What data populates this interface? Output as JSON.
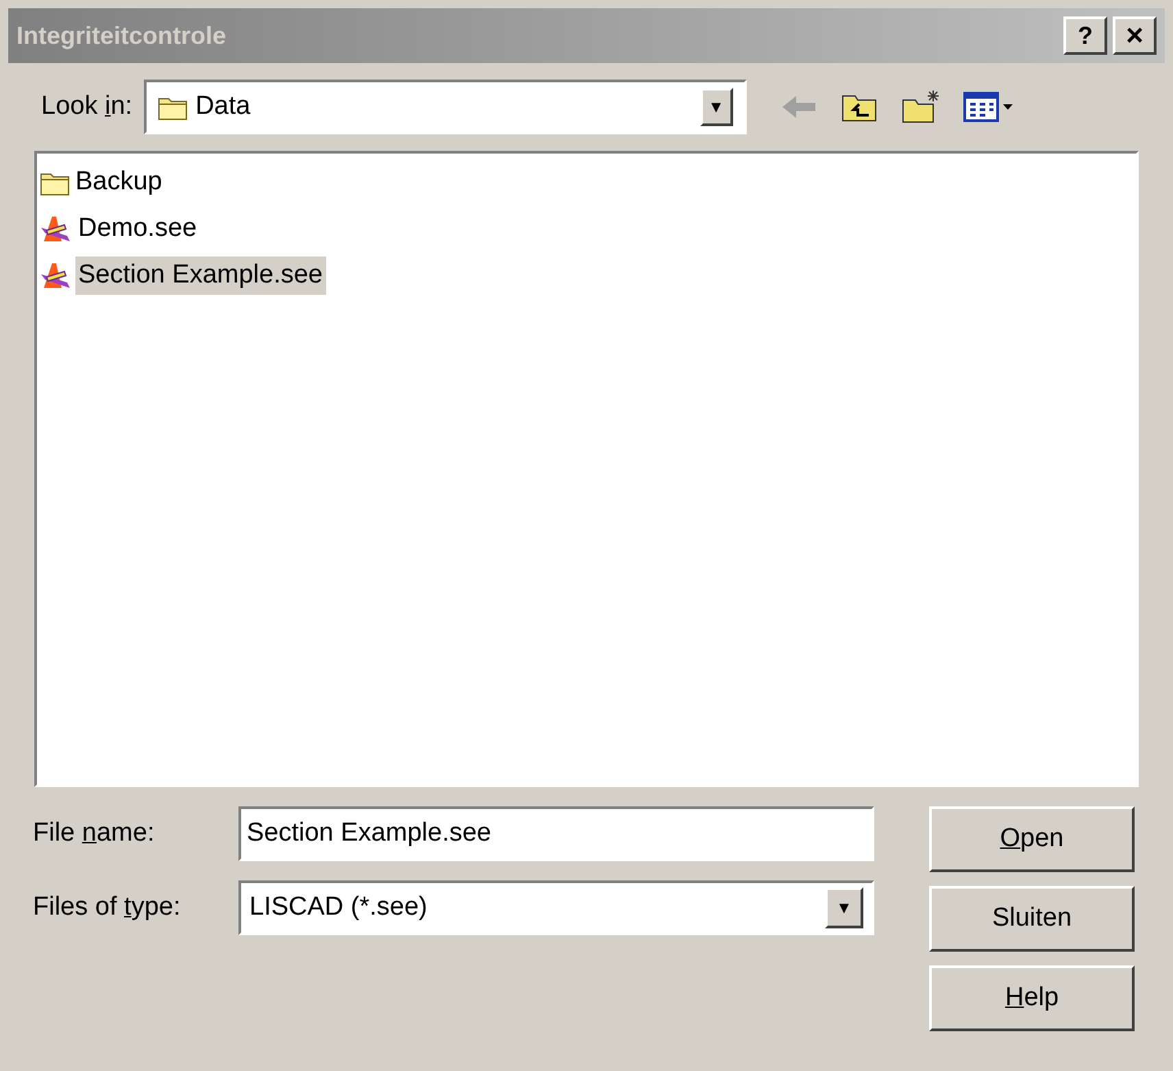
{
  "window": {
    "title": "Integriteitcontrole",
    "help_button": "?",
    "close_button": "×"
  },
  "look_in": {
    "label": {
      "before": "Look ",
      "key": "i",
      "after": "n:"
    },
    "value": "Data",
    "dropdown": "▼"
  },
  "files": [
    {
      "name": "Backup",
      "kind": "folder",
      "selected": false
    },
    {
      "name": "Demo.see",
      "kind": "document",
      "selected": false
    },
    {
      "name": "Section Example.see",
      "kind": "document",
      "selected": true
    }
  ],
  "file_name": {
    "label": {
      "before": "File ",
      "key": "n",
      "after": "ame:"
    },
    "value": "Section Example.see"
  },
  "file_type": {
    "label": {
      "before": "Files of ",
      "key": "t",
      "after": "ype:"
    },
    "value": "LISCAD (*.see)",
    "dropdown": "▼"
  },
  "buttons": [
    {
      "label": {
        "key": "O",
        "after": "pen"
      }
    },
    {
      "label": {
        "after": "Sluiten"
      }
    },
    {
      "label": {
        "key": "H",
        "after": "elp"
      }
    }
  ]
}
